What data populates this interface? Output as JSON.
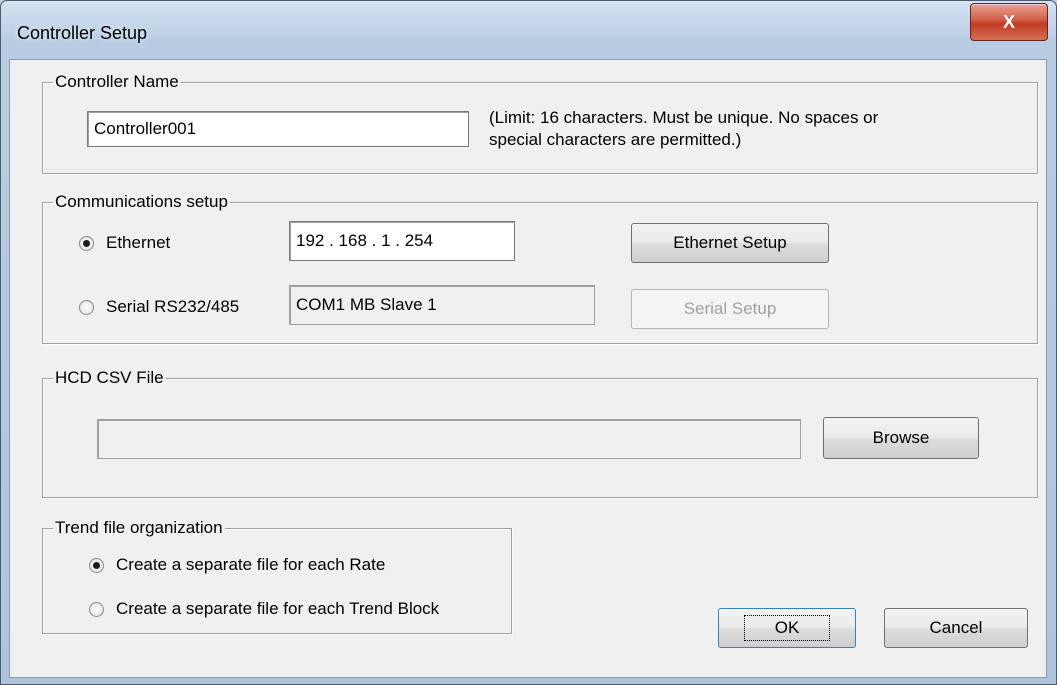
{
  "window": {
    "title": "Controller Setup",
    "close_glyph": "X"
  },
  "controller_name": {
    "legend": "Controller Name",
    "value": "Controller001",
    "note_line1": "(Limit: 16 characters.  Must be unique.  No spaces or",
    "note_line2": "special characters are permitted.)"
  },
  "communications": {
    "legend": "Communications setup",
    "ethernet": {
      "label": "Ethernet",
      "selected": true,
      "address": "192 . 168 .   1   . 254",
      "setup_button": "Ethernet Setup"
    },
    "serial": {
      "label": "Serial RS232/485",
      "selected": false,
      "port": "COM1  MB Slave 1",
      "setup_button": "Serial Setup",
      "setup_enabled": false
    }
  },
  "hcd_csv": {
    "legend": "HCD CSV File",
    "path": "",
    "browse_button": "Browse"
  },
  "trend": {
    "legend": "Trend file organization",
    "options": [
      {
        "label": "Create a separate file for each Rate",
        "selected": true
      },
      {
        "label": "Create a separate file for each Trend Block",
        "selected": false
      }
    ]
  },
  "buttons": {
    "ok": "OK",
    "cancel": "Cancel"
  }
}
